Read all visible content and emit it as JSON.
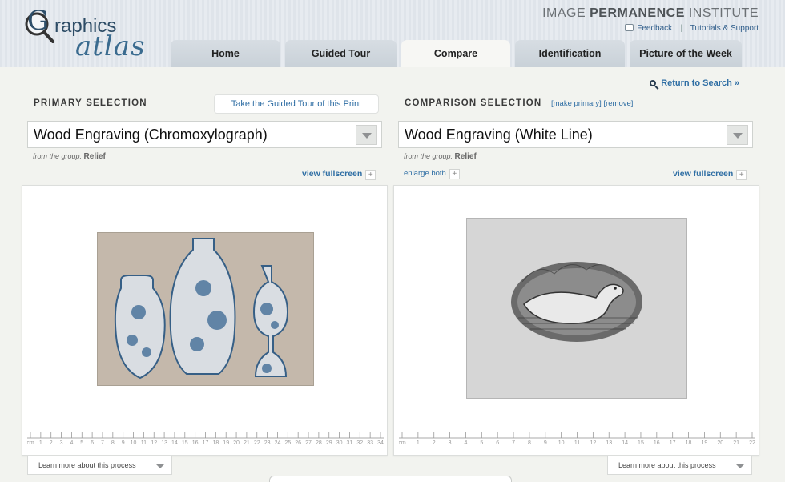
{
  "header": {
    "logo_g": "G",
    "logo_graphics": "raphics",
    "logo_atlas": "atlas",
    "institute": {
      "light1": "IMAGE ",
      "bold": "PERMANENCE",
      "light2": " INSTITUTE"
    },
    "links": {
      "feedback": "Feedback",
      "separator": "|",
      "tutorials": "Tutorials & Support"
    }
  },
  "tabs": [
    {
      "label": "Home",
      "active": false
    },
    {
      "label": "Guided Tour",
      "active": false
    },
    {
      "label": "Compare",
      "active": true
    },
    {
      "label": "Identification",
      "active": false
    },
    {
      "label": "Picture of the Week",
      "active": false
    }
  ],
  "return_link": "Return to Search »",
  "primary": {
    "section_title": "PRIMARY SELECTION",
    "tour_button": "Take the Guided Tour of this Print",
    "selected": "Wood Engraving (Chromoxylograph)",
    "group_prefix": "from the group:",
    "group": "Relief",
    "fullscreen": "view fullscreen",
    "learn_more": "Learn more about this process",
    "ruler_ticks": [
      "cm",
      "1",
      "2",
      "3",
      "4",
      "5",
      "6",
      "7",
      "8",
      "9",
      "10",
      "11",
      "12",
      "13",
      "14",
      "15",
      "16",
      "17",
      "18",
      "19",
      "20",
      "21",
      "22",
      "23",
      "24",
      "25",
      "26",
      "27",
      "28",
      "29",
      "30",
      "31",
      "32",
      "33",
      "34"
    ]
  },
  "comparison": {
    "section_title": "COMPARISON SELECTION",
    "make_primary": "[make primary]",
    "remove": "[remove]",
    "selected": "Wood Engraving (White Line)",
    "group_prefix": "from the group:",
    "group": "Relief",
    "enlarge_both": "enlarge both",
    "fullscreen": "view fullscreen",
    "learn_more": "Learn more about this process",
    "ruler_ticks": [
      "cm",
      "1",
      "2",
      "3",
      "4",
      "5",
      "6",
      "7",
      "8",
      "9",
      "10",
      "11",
      "12",
      "13",
      "14",
      "15",
      "16",
      "17",
      "18",
      "19",
      "20",
      "21",
      "22"
    ]
  },
  "plus": "+",
  "icons": {
    "search": "search-icon",
    "feedback": "speech-bubble-icon",
    "dropdown": "chevron-down-icon"
  }
}
